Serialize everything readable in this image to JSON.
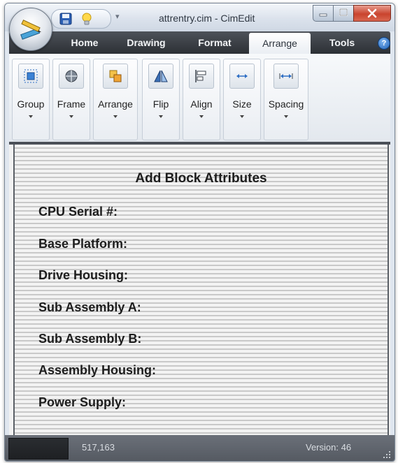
{
  "window": {
    "title": "attrentry.cim - CimEdit"
  },
  "tabs": [
    {
      "label": "Home",
      "active": false
    },
    {
      "label": "Drawing",
      "active": false
    },
    {
      "label": "Format",
      "active": false
    },
    {
      "label": "Arrange",
      "active": true
    },
    {
      "label": "Tools",
      "active": false
    }
  ],
  "help": {
    "glyph": "?"
  },
  "ribbon": {
    "buttons": [
      {
        "label": "Group",
        "icon": "group-icon"
      },
      {
        "label": "Frame",
        "icon": "frame-icon"
      },
      {
        "label": "Arrange",
        "icon": "arrange-icon"
      },
      {
        "label": "Flip",
        "icon": "flip-icon"
      },
      {
        "label": "Align",
        "icon": "align-icon"
      },
      {
        "label": "Size",
        "icon": "size-icon"
      },
      {
        "label": "Spacing",
        "icon": "spacing-icon"
      }
    ]
  },
  "document": {
    "title": "Add Block Attributes",
    "fields": [
      "CPU Serial #:",
      "Base Platform:",
      "Drive Housing:",
      "Sub Assembly A:",
      "Sub Assembly B:",
      "Assembly Housing:",
      "Power Supply:"
    ]
  },
  "status": {
    "coords": "517,163",
    "version": "Version: 46"
  },
  "colors": {
    "tabbar": "#3a3f45",
    "accent_blue": "#1f62b8",
    "close_red": "#c9442e"
  }
}
